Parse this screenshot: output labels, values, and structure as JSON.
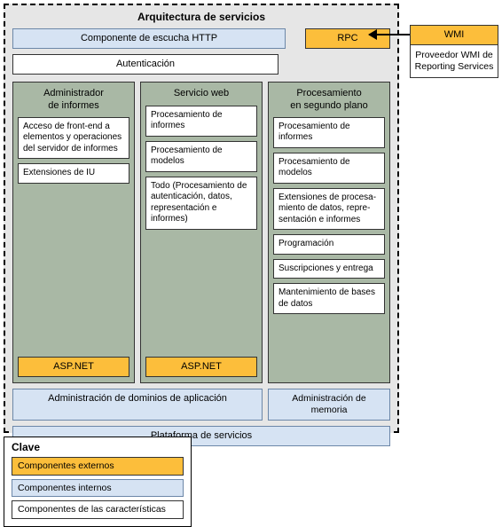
{
  "arch": {
    "title": "Arquitectura de servicios",
    "http_listener": "Componente de escucha HTTP",
    "rpc": "RPC",
    "auth": "Autenticación",
    "columns": {
      "report_manager": {
        "title": "Administrador\nde informes",
        "features": [
          "Acceso de front-end a elementos y opera­ciones del servidor de informes",
          "Extensiones de IU"
        ],
        "aspnet": "ASP.NET"
      },
      "web_service": {
        "title": "Servicio web",
        "features": [
          "Procesamiento de informes",
          "Procesamiento de modelos",
          "Todo (Procesamiento de autenticación, datos, representación e informes)"
        ],
        "aspnet": "ASP.NET"
      },
      "background": {
        "title": "Procesamiento\nen segundo plano",
        "features": [
          "Procesamiento de informes",
          "Procesamiento de modelos",
          "Extensiones de procesa­miento de datos, repre­sentación e informes",
          "Programación",
          "Suscripciones y entrega",
          "Mantenimiento de bases de datos"
        ]
      }
    },
    "app_domain_admin": "Administración de dominios de aplicación",
    "memory_admin": "Administración de memoria",
    "service_platform": "Plataforma de servicios"
  },
  "wmi": {
    "title": "WMI",
    "desc": "Proveedor WMI de Reporting Services"
  },
  "legend": {
    "title": "Clave",
    "external": "Componentes externos",
    "internal": "Componentes internos",
    "feature": "Componentes de las características"
  }
}
